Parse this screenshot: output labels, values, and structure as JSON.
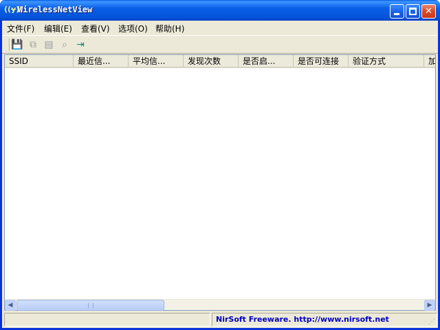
{
  "window": {
    "title": "WirelessNetView"
  },
  "menu": {
    "items": [
      "文件(F)",
      "编辑(E)",
      "查看(V)",
      "选项(O)",
      "帮助(H)"
    ]
  },
  "toolbar": {
    "icons": [
      {
        "name": "save-icon",
        "glyph": "💾",
        "enabled": false
      },
      {
        "name": "copy-icon",
        "glyph": "⧉",
        "enabled": false
      },
      {
        "name": "properties-icon",
        "glyph": "▤",
        "enabled": false
      },
      {
        "name": "find-icon",
        "glyph": "⌕",
        "enabled": false
      },
      {
        "name": "exit-icon",
        "glyph": "⇥",
        "enabled": true
      }
    ]
  },
  "columns": [
    "SSID",
    "最近信...",
    "平均信...",
    "发现次数",
    "是否启...",
    "是否可连接",
    "验证方式",
    "加"
  ],
  "status": {
    "left": "",
    "right": "NirSoft Freeware.  http://www.nirsoft.net"
  },
  "colors": {
    "title_bar": "#0a5fe6",
    "link": "#0000c0"
  }
}
